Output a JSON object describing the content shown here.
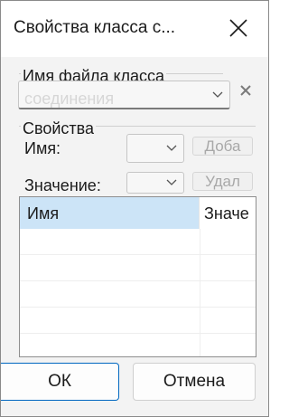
{
  "dialog": {
    "title": "Свойства класса с..."
  },
  "file_group": {
    "label": "Имя файла класса",
    "ghost_text": "соединения"
  },
  "props_group": {
    "label": "Свойства",
    "name_label": "Имя:",
    "value_label": "Значение:",
    "add_button": "Доба",
    "delete_button": "Удал"
  },
  "list": {
    "columns": [
      "Имя",
      "Значе"
    ]
  },
  "buttons": {
    "ok": "ОК",
    "cancel": "Отмена"
  }
}
